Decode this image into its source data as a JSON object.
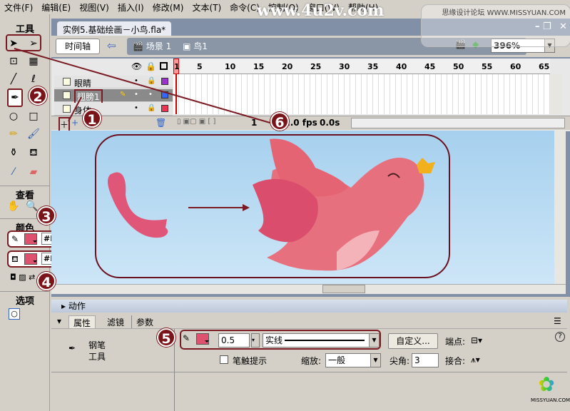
{
  "menu": [
    "文件(F)",
    "编辑(E)",
    "视图(V)",
    "插入(I)",
    "修改(M)",
    "文本(T)",
    "命令(C)",
    "控制(O)",
    "窗口(W)",
    "帮助(H)"
  ],
  "watermark": {
    "site": "www.4u2v.com",
    "forum": "思缘设计论坛 WWW.MISSYUAN.COM"
  },
  "tools": {
    "title": "工具",
    "view_title": "查看",
    "color_title": "颜色",
    "options_title": "选项",
    "stroke_color": "#DE526F",
    "fill_color": "#DE526F"
  },
  "document": {
    "title": "实例5.基础绘画－小鸟.fla*",
    "timeline_button": "时间轴",
    "scene": "场景 1",
    "symbol": "鸟1",
    "zoom": "396%"
  },
  "timeline": {
    "frame_numbers": [
      "1",
      "5",
      "10",
      "15",
      "20",
      "25",
      "30",
      "35",
      "40",
      "45",
      "50",
      "55",
      "60",
      "65"
    ],
    "layers": [
      {
        "name": "眼睛",
        "color": "#9933cc"
      },
      {
        "name": "翅膀1",
        "color": "#3366ff",
        "selected": true
      },
      {
        "name": "身体",
        "color": "#ee3355"
      }
    ],
    "current_frame": "1",
    "fps": "12.0 fps",
    "time": "0.0s"
  },
  "panels": {
    "actions": "动作",
    "tabs": [
      "属性",
      "滤镜",
      "参数"
    ]
  },
  "properties": {
    "tool_name_line1": "钢笔",
    "tool_name_line2": "工具",
    "stroke_width": "0.5",
    "stroke_style": "实线",
    "custom_button": "自定义...",
    "cap_label": "端点:",
    "stroke_hint": "笔触提示",
    "scale_label": "缩放:",
    "scale_value": "一般",
    "miter_label": "尖角:",
    "miter_value": "3",
    "join_label": "接合:",
    "help": "?"
  },
  "badges": [
    "1",
    "2",
    "3",
    "4",
    "5",
    "6"
  ],
  "logo": "MISSYUAN.COM"
}
